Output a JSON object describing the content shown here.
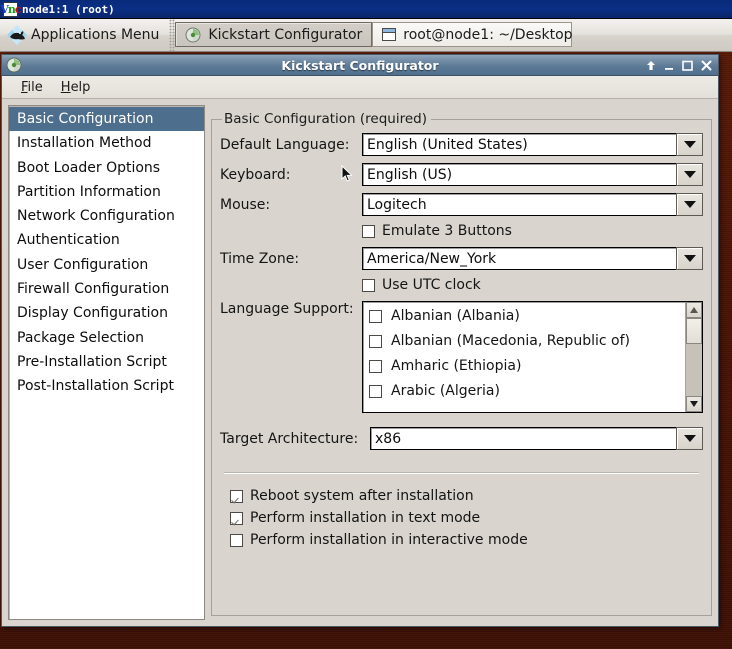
{
  "vnc": {
    "logo_letters": [
      "V",
      "n",
      "c"
    ],
    "title": "node1:1 (root)"
  },
  "taskbar": {
    "apps_menu_label": "Applications Menu",
    "apps_menu_icon": "xfce-mouse-icon",
    "tasks": [
      {
        "label": "Kickstart Configurator",
        "icon": "kickstart-icon",
        "active": true
      },
      {
        "label": "root@node1: ~/Desktop",
        "icon": "terminal-icon",
        "active": false
      }
    ]
  },
  "window": {
    "title": "Kickstart Configurator",
    "icon": "kickstart-icon",
    "controls": [
      {
        "name": "shade-button",
        "glyph": "↑"
      },
      {
        "name": "minimize-button",
        "glyph": "_"
      },
      {
        "name": "maximize-button",
        "glyph": "□"
      },
      {
        "name": "close-button",
        "glyph": "✕"
      }
    ],
    "menus": [
      {
        "label": "File",
        "mnemonic": "F"
      },
      {
        "label": "Help",
        "mnemonic": "H"
      }
    ]
  },
  "sidebar": {
    "items": [
      {
        "label": "Basic Configuration",
        "selected": true
      },
      {
        "label": "Installation Method",
        "selected": false
      },
      {
        "label": "Boot Loader Options",
        "selected": false
      },
      {
        "label": "Partition Information",
        "selected": false
      },
      {
        "label": "Network Configuration",
        "selected": false
      },
      {
        "label": "Authentication",
        "selected": false
      },
      {
        "label": "User Configuration",
        "selected": false
      },
      {
        "label": "Firewall Configuration",
        "selected": false
      },
      {
        "label": "Display Configuration",
        "selected": false
      },
      {
        "label": "Package Selection",
        "selected": false
      },
      {
        "label": "Pre-Installation Script",
        "selected": false
      },
      {
        "label": "Post-Installation Script",
        "selected": false
      }
    ]
  },
  "form": {
    "group_title": "Basic Configuration (required)",
    "default_language": {
      "label": "Default Language:",
      "value": "English (United States)"
    },
    "keyboard": {
      "label": "Keyboard:",
      "value": "English (US)"
    },
    "mouse": {
      "label": "Mouse:",
      "value": "Logitech"
    },
    "emulate_3_buttons": {
      "label": "Emulate 3 Buttons",
      "checked": false
    },
    "time_zone": {
      "label": "Time Zone:",
      "value": "America/New_York"
    },
    "use_utc_clock": {
      "label": "Use UTC clock",
      "checked": false
    },
    "language_support": {
      "label": "Language Support:",
      "items": [
        {
          "label": "Albanian (Albania)",
          "checked": false
        },
        {
          "label": "Albanian (Macedonia, Republic of)",
          "checked": false
        },
        {
          "label": "Amharic (Ethiopia)",
          "checked": false
        },
        {
          "label": "Arabic (Algeria)",
          "checked": false
        }
      ]
    },
    "target_architecture": {
      "label": "Target Architecture:",
      "value": "x86"
    },
    "options": [
      {
        "label": "Reboot system after installation",
        "checked": true
      },
      {
        "label": "Perform installation in text mode",
        "checked": true
      },
      {
        "label": "Perform installation in interactive mode",
        "checked": false
      }
    ]
  },
  "colors": {
    "desktop": "#4a1205",
    "vnc_titlebar": "#0b2f86",
    "window_titlebar": "#5d7a96",
    "selection": "#4d6e8c",
    "window_bg": "#d9d5ce"
  }
}
